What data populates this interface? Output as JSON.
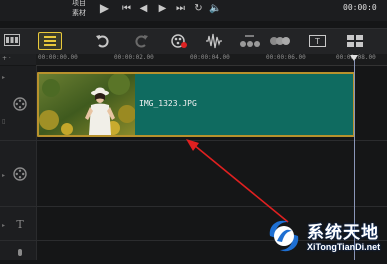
{
  "player": {
    "project_label": "项目",
    "clip_label": "素材",
    "timecode": "00:00:0"
  },
  "ruler": {
    "ticks": [
      "00:00:00.00",
      "00:00:02.00",
      "00:00:04.00",
      "00:00:06.00",
      "00:00:08.00"
    ]
  },
  "clip": {
    "file_name": "IMG_1323.JPG"
  },
  "watermark": {
    "title": "系统天地",
    "subtitle": "XiTongTianDi.net"
  },
  "colors": {
    "clip_fill": "#0f6b60",
    "clip_border": "#b8922d",
    "arrow": "#e02020",
    "selected_tool": "#e9c93b"
  },
  "icons": {
    "play": "play-icon",
    "timeline_view": "timeline-view-icon",
    "undo": "undo-icon",
    "redo": "redo-icon"
  }
}
